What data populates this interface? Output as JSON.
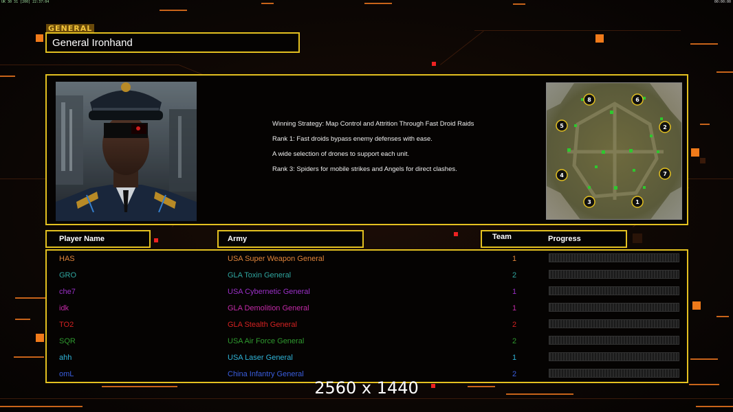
{
  "status_bar": {
    "left": "UK 30 31 [200] 22:37:04",
    "right": "00:00:00"
  },
  "general": {
    "section_label": "GENERAL",
    "name": "General Ironhand",
    "strategy_lines": [
      "Winning Strategy: Map Control and Attrition Through Fast Droid Raids",
      "Rank 1: Fast droids bypass enemy defenses with ease.",
      "A wide selection of drones to support each unit.",
      "Rank 3: Spiders for mobile strikes and Angels for direct clashes."
    ]
  },
  "minimap": {
    "spawn_labels": [
      "8",
      "6",
      "5",
      "2",
      "4",
      "7",
      "3",
      "1"
    ]
  },
  "table": {
    "headers": {
      "player": "Player Name",
      "army": "Army",
      "team": "Team",
      "progress": "Progress"
    },
    "rows": [
      {
        "player": "HAS",
        "army": "USA Super Weapon General",
        "team": "1",
        "progress": 0,
        "color": "#e0843a"
      },
      {
        "player": "GRO",
        "army": "GLA Toxin General",
        "team": "2",
        "progress": 0,
        "color": "#2fa6a0"
      },
      {
        "player": "che7",
        "army": "USA Cybernetic General",
        "team": "1",
        "progress": 0,
        "color": "#9b30c8"
      },
      {
        "player": "idk",
        "army": "GLA Demolition General",
        "team": "1",
        "progress": 0,
        "color": "#c42aa8"
      },
      {
        "player": "TO2",
        "army": "GLA Stealth General",
        "team": "2",
        "progress": 0,
        "color": "#d42222"
      },
      {
        "player": "SQR",
        "army": "USA Air Force General",
        "team": "2",
        "progress": 0,
        "color": "#2f9a2f"
      },
      {
        "player": "ahh",
        "army": "USA Laser General",
        "team": "1",
        "progress": 0,
        "color": "#2fb4d8"
      },
      {
        "player": "omL",
        "army": "China Infantry General",
        "team": "2",
        "progress": 0,
        "color": "#3a5ee0"
      }
    ]
  },
  "overlay": {
    "resolution": "2560 x 1440"
  },
  "colors": {
    "frame": "#e4c120",
    "accent": "#f07a1a"
  }
}
